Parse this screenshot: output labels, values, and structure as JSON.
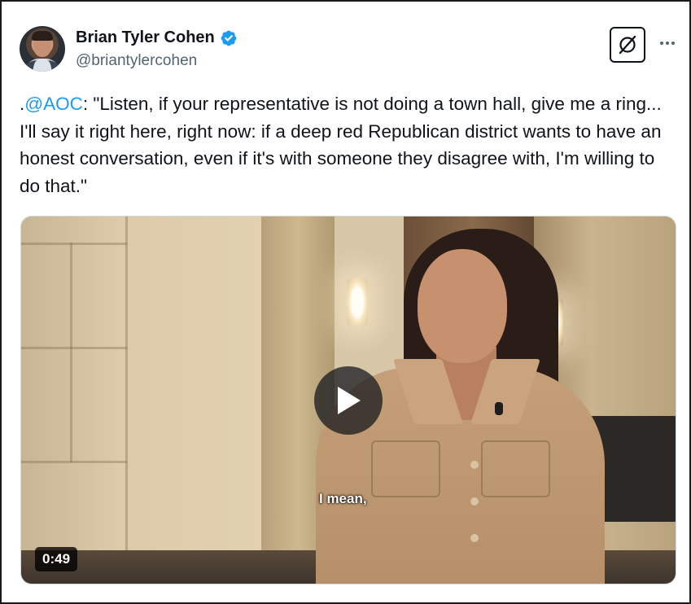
{
  "author": {
    "name": "Brian Tyler Cohen",
    "handle": "@briantylercohen",
    "verified": true,
    "verified_icon": "verified-badge-icon",
    "verified_color": "#1d9bf0"
  },
  "actions": {
    "grok_icon": "grok-icon",
    "more_icon": "more-options-icon"
  },
  "tweet": {
    "prefix": ".",
    "mention": "@AOC",
    "body": ": \"Listen, if your representative is not doing a town hall, give me a ring... I'll say it right here, right now: if a deep red Republican district wants to have an honest conversation, even if it's with someone they disagree with, I'm willing to do that.\"",
    "mention_color": "#1d9bf0"
  },
  "video": {
    "caption": "I mean,",
    "duration": "0:49",
    "play_icon": "play-icon"
  }
}
